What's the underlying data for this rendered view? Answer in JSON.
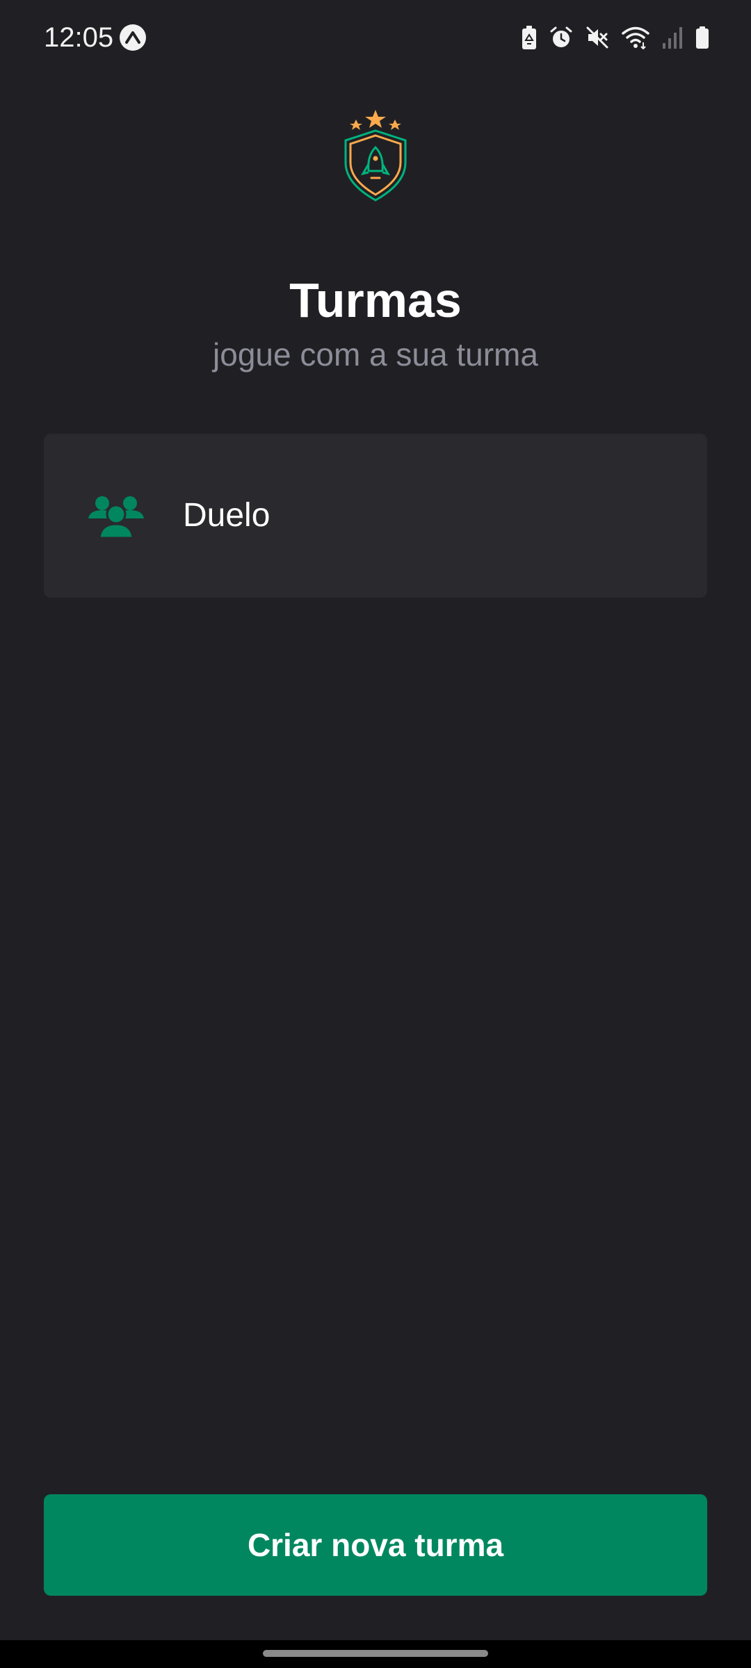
{
  "status_bar": {
    "time": "12:05",
    "app_icon": "expo-icon",
    "icons": [
      "battery-saver-icon",
      "alarm-icon",
      "mute-icon",
      "wifi-icon",
      "cellular-signal-icon",
      "battery-icon"
    ]
  },
  "header": {
    "logo_icon": "shield-rocket-stars-logo",
    "title": "Turmas",
    "subtitle": "jogue com a sua turma"
  },
  "teams": [
    {
      "icon": "users-group-icon",
      "name": "Duelo"
    }
  ],
  "actions": {
    "create_label": "Criar nova turma"
  },
  "colors": {
    "background": "#202024",
    "card": "#29292e",
    "accent_green": "#00875f",
    "subtitle_gray": "#8d8d99",
    "star_orange": "#fba94c"
  }
}
